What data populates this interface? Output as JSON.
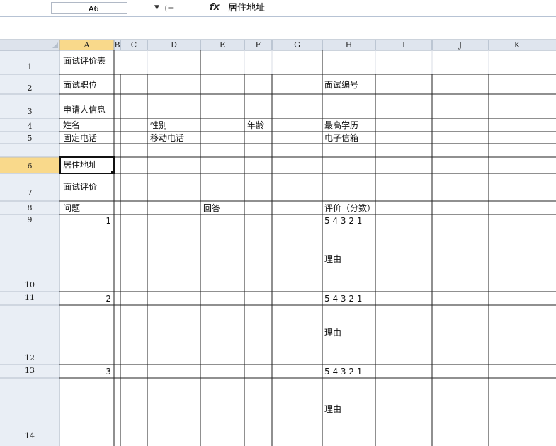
{
  "formula_bar": {
    "name_box": "A6",
    "fx_symbol": "fx",
    "content": "居住地址"
  },
  "columns": [
    "A",
    "B",
    "C",
    "D",
    "E",
    "F",
    "G",
    "H",
    "I",
    "J",
    "K"
  ],
  "rows": [
    "1",
    "2",
    "3",
    "4",
    "5",
    "6",
    "7",
    "8",
    "9",
    "10",
    "11",
    "12",
    "13",
    "14"
  ],
  "cells": {
    "A1": "面试评价表",
    "A2": "面试职位",
    "H2": "面试编号",
    "A3": "申请人信息",
    "A4": "姓名",
    "D4": "性别",
    "F4": "年龄",
    "H4": "最高学历",
    "A5": "固定电话",
    "D5": "移动电话",
    "H5": "电子信箱",
    "A6": "居住地址",
    "A7": "面试评价",
    "A8": "问题",
    "E8": "回答",
    "H8": "评价（分数）",
    "A9": "1",
    "H9": "5 4 3 2 1",
    "H10": "理由",
    "A11": "2",
    "H11": "5 4 3 2 1",
    "H12": "理由",
    "A13": "3",
    "H13": "5 4 3 2 1",
    "H14": "理由"
  }
}
